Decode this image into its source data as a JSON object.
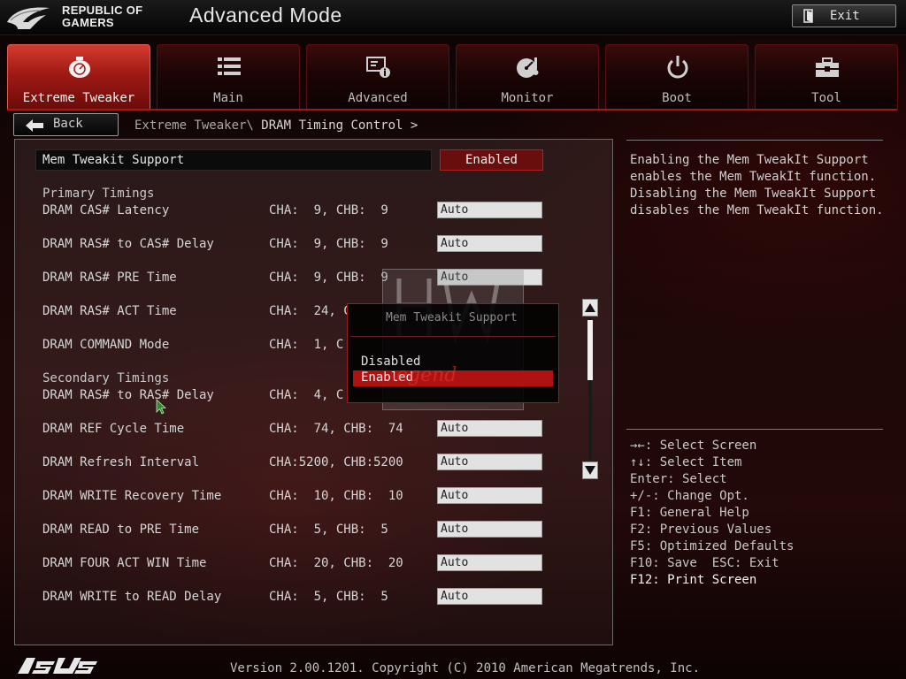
{
  "header": {
    "brand_line1": "REPUBLIC OF",
    "brand_line2": "GAMERS",
    "mode_title": "Advanced Mode",
    "exit_label": "Exit"
  },
  "tabs": [
    {
      "label": "Extreme Tweaker",
      "icon": "tweaker-icon",
      "active": true
    },
    {
      "label": "Main",
      "icon": "list-icon",
      "active": false
    },
    {
      "label": "Advanced",
      "icon": "advanced-icon",
      "active": false
    },
    {
      "label": "Monitor",
      "icon": "monitor-icon",
      "active": false
    },
    {
      "label": "Boot",
      "icon": "power-icon",
      "active": false
    },
    {
      "label": "Tool",
      "icon": "toolbox-icon",
      "active": false
    }
  ],
  "nav": {
    "back_label": "Back",
    "breadcrumb_parent": "Extreme Tweaker\\ ",
    "breadcrumb_current": "DRAM Timing Control >"
  },
  "settings": {
    "tweakit": {
      "label": "Mem Tweakit Support",
      "value": "Enabled"
    },
    "primary_title": "Primary Timings",
    "primary": [
      {
        "label": "DRAM CAS# Latency",
        "value": "CHA:  9, CHB:  9",
        "setting": "Auto"
      },
      {
        "label": "DRAM RAS# to CAS# Delay",
        "value": "CHA:  9, CHB:  9",
        "setting": "Auto"
      },
      {
        "label": "DRAM RAS# PRE Time",
        "value": "CHA:  9, CHB:  9",
        "setting": "Auto"
      },
      {
        "label": "DRAM RAS# ACT Time",
        "value": "CHA:  24, C",
        "setting": ""
      },
      {
        "label": "DRAM COMMAND Mode",
        "value": "CHA:  1, C",
        "setting": ""
      }
    ],
    "secondary_title": "Secondary Timings",
    "secondary": [
      {
        "label": "DRAM RAS# to RAS# Delay",
        "value": "CHA:  4, C",
        "setting": ""
      },
      {
        "label": "DRAM REF Cycle Time",
        "value": "CHA:  74, CHB:  74",
        "setting": "Auto"
      },
      {
        "label": "DRAM Refresh Interval",
        "value": "CHA:5200, CHB:5200",
        "setting": "Auto"
      },
      {
        "label": "DRAM WRITE Recovery Time",
        "value": "CHA:  10, CHB:  10",
        "setting": "Auto"
      },
      {
        "label": "DRAM READ to PRE Time",
        "value": "CHA:  5, CHB:  5",
        "setting": "Auto"
      },
      {
        "label": "DRAM FOUR ACT WIN Time",
        "value": "CHA:  20, CHB:  20",
        "setting": "Auto"
      },
      {
        "label": "DRAM WRITE to READ Delay",
        "value": "CHA:  5, CHB:  5",
        "setting": "Auto"
      }
    ]
  },
  "popup": {
    "title": "Mem Tweakit Support",
    "options": [
      "Disabled",
      "Enabled"
    ],
    "selected": "Enabled",
    "watermark": "egend"
  },
  "help": {
    "description": "Enabling the Mem TweakIt Support\nenables the Mem TweakIt function.\nDisabling the Mem TweakIt Support\ndisables the Mem TweakIt function.",
    "keys": [
      "→←: Select Screen",
      "↑↓: Select Item",
      "Enter: Select",
      "+/-: Change Opt.",
      "F1: General Help",
      "F2: Previous Values",
      "F5: Optimized Defaults",
      "F10: Save  ESC: Exit",
      "F12: Print Screen"
    ]
  },
  "footer": {
    "version": "Version 2.00.1201. Copyright (C) 2010 American Megatrends, Inc."
  },
  "colors": {
    "accent": "#a01a14",
    "active_tab": "#c0281f",
    "selected_option": "#b01212",
    "field_bg": "#e2e2e2"
  }
}
